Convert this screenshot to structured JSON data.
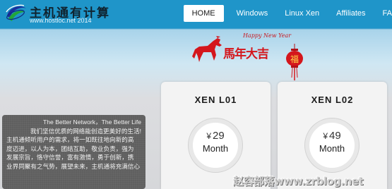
{
  "header": {
    "logo_text": "主机通有计算",
    "logo_url": "www.hostloc.net 2014"
  },
  "nav": {
    "items": [
      "HOME",
      "Windows",
      "Linux Xen",
      "Affiliates",
      "FA"
    ]
  },
  "banner": {
    "greeting": "Happy New Year",
    "slogan": "馬年大吉",
    "lantern_char": "福"
  },
  "plans": [
    {
      "name": "XEN L01",
      "currency": "¥",
      "price": "29",
      "period": "Month"
    },
    {
      "name": "XEN L02",
      "currency": "¥",
      "price": "49",
      "period": "Month"
    }
  ],
  "about": {
    "tagline": "The Better Network，The Better Life",
    "lines": [
      "我们坚信优质的网络能创造更美好的生活!",
      "主机通倾听用户的需求，将一如既往地向新的高",
      "度迈进，以人为本，团结互助，敬业负责，强为",
      "发展宗旨，恪守信誉，富有激情，勇于创新，携",
      "业界同聚有之气势，展望未来，主机通将充满信心"
    ]
  },
  "watermark": "赵容部落www.zrblog.net",
  "colors": {
    "header_bg": "#1f95c9",
    "accent_red": "#d4161c",
    "about_bg": "#5f5f5f"
  }
}
